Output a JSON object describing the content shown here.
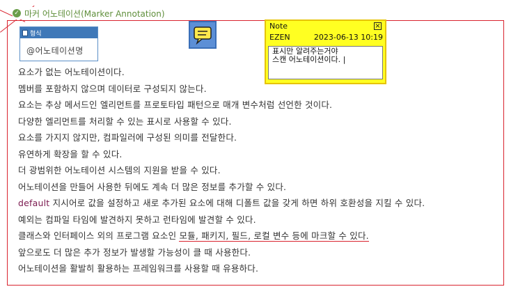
{
  "header": {
    "title": "마커 어노테이션(Marker Annotation)"
  },
  "type_box": {
    "title": "형식",
    "value": "@어노테이션명"
  },
  "note": {
    "label": "Note",
    "author": "EZEN",
    "timestamp": "2023-06-13 10:19",
    "text": "표시만 알려주는거야\n스캔 어노테이션이다. |"
  },
  "lines": [
    "요소가 없는 어노테이션이다.",
    "멤버를 포함하지 않으며 데이터로 구성되지 않는다.",
    "요소는 추상 메서드인 엘리먼트를 프로토타입 패턴으로 매개 변수처럼 선언한 것이다.",
    "다양한 엘리먼트를 처리할 수 있는 표시로 사용할 수 있다.",
    "요소를 가지지 않지만, 컴파일러에 구성된 의미를 전달한다.",
    "유연하게 확장을 할 수 있다.",
    "더 광범위한 어노테이션 시스템의 지원을 받을 수 있다.",
    "어노테이션을 만들어 사용한 뒤에도 계속 더 많은 정보를 추가할 수 있다.",
    {
      "keyword": "default",
      "rest": " 지시어로 값을 설정하고 새로 추가된 요소에 대해 디폴트 값을 갖게 하면 하위 호환성을 지킬 수 있다."
    },
    "예외는 컴파일 타임에 발견하지 못하고 런타임에 발견할 수 있다.",
    {
      "prefix": "클래스와 인터페이스 외의 프로그램 요소인 ",
      "underlined": "모듈, 패키지, 필드, 로컬 변수 등에 마크할 수 있다."
    },
    "앞으로도 더 많은 추가 정보가 발생할 가능성이 클 때 사용한다.",
    "어노테이션을 활발히 활용하는 프레임워크를 사용할 때 유용하다."
  ]
}
